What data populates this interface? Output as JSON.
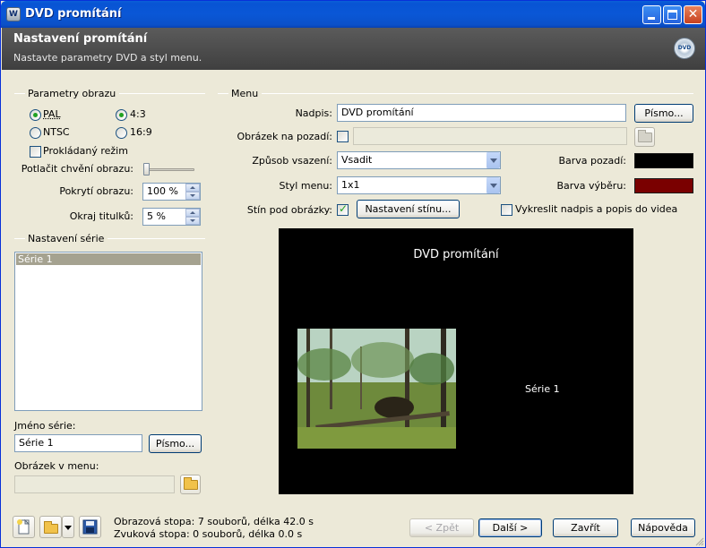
{
  "window": {
    "title": "DVD promítání",
    "app_icon": "app-icon",
    "controls": [
      "minimize-icon",
      "maximize-icon",
      "close-icon"
    ]
  },
  "header": {
    "title": "Nastavení promítání",
    "subtitle": "Nastavte parametry DVD a styl menu.",
    "icon": "dvd-disc-icon",
    "icon_text": "DVD"
  },
  "params": {
    "group_label": "Parametry obrazu",
    "pal_label": "PAL",
    "ntsc_label": "NTSC",
    "ratio43_label": "4:3",
    "ratio169_label": "16:9",
    "tv_system_selected": "PAL",
    "aspect_selected": "4:3",
    "interlaced_label": "Prokládaný režim",
    "interlaced_checked": false,
    "shake_label": "Potlačit chvění obrazu:",
    "shake_level": 0,
    "coverage_label": "Pokrytí obrazu:",
    "coverage_value": "100 %",
    "title_margin_label": "Okraj titulků:",
    "title_margin_value": "5 %"
  },
  "series": {
    "group_label": "Nastavení série",
    "items": [
      "Série 1"
    ],
    "selected_index": 0,
    "name_label": "Jméno série:",
    "name_value": "Série 1",
    "font_button": "Písmo...",
    "menu_image_label": "Obrázek v menu:",
    "menu_image_value": ""
  },
  "menu": {
    "group_label": "Menu",
    "caption_label": "Nadpis:",
    "caption_value": "DVD promítání",
    "font_button": "Písmo...",
    "bg_image_label": "Obrázek na pozadí:",
    "bg_image_checked": false,
    "bg_image_value": "",
    "embed_label": "Způsob vsazení:",
    "embed_value": "Vsadit",
    "style_label": "Styl menu:",
    "style_value": "1x1",
    "bg_color_label": "Barva pozadí:",
    "bg_color": "#000000",
    "sel_color_label": "Barva výběru:",
    "sel_color": "#7a0000",
    "shadow_label": "Stín pod obrázky:",
    "shadow_checked": true,
    "shadow_button": "Nastavení stínu...",
    "draw_caption_label": "Vykreslit nadpis a popis do videa",
    "draw_caption_checked": false
  },
  "preview": {
    "title": "DVD promítání",
    "series_label": "Série 1"
  },
  "status": {
    "video_track": "Obrazová stopa: 7 souborů, délka 42.0 s",
    "audio_track": "Zvuková stopa: 0 souborů, délka 0.0 s",
    "toolbar_icons": [
      "new-project-icon",
      "open-folder-icon",
      "dropdown-arrow-icon",
      "save-disk-icon"
    ]
  },
  "buttons": {
    "back": "< Zpět",
    "next": "Další >",
    "close": "Zavřít",
    "help": "Nápověda"
  }
}
